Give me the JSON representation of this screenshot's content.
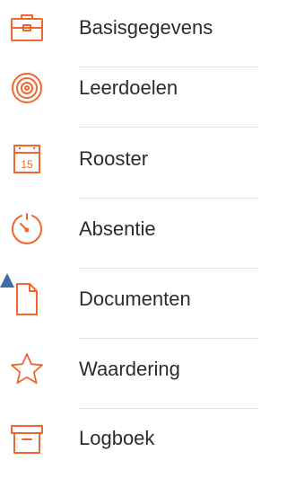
{
  "menu": {
    "accent_color": "#f0662e",
    "pointer_color": "#3a6ea5",
    "items": [
      {
        "label": "Basisgegevens",
        "icon": "briefcase-icon"
      },
      {
        "label": "Leerdoelen",
        "icon": "target-icon"
      },
      {
        "label": "Rooster",
        "icon": "calendar-icon",
        "icon_text": "15"
      },
      {
        "label": "Absentie",
        "icon": "timer-icon"
      },
      {
        "label": "Documenten",
        "icon": "document-icon"
      },
      {
        "label": "Waardering",
        "icon": "star-icon"
      },
      {
        "label": "Logboek",
        "icon": "archive-box-icon"
      }
    ]
  }
}
